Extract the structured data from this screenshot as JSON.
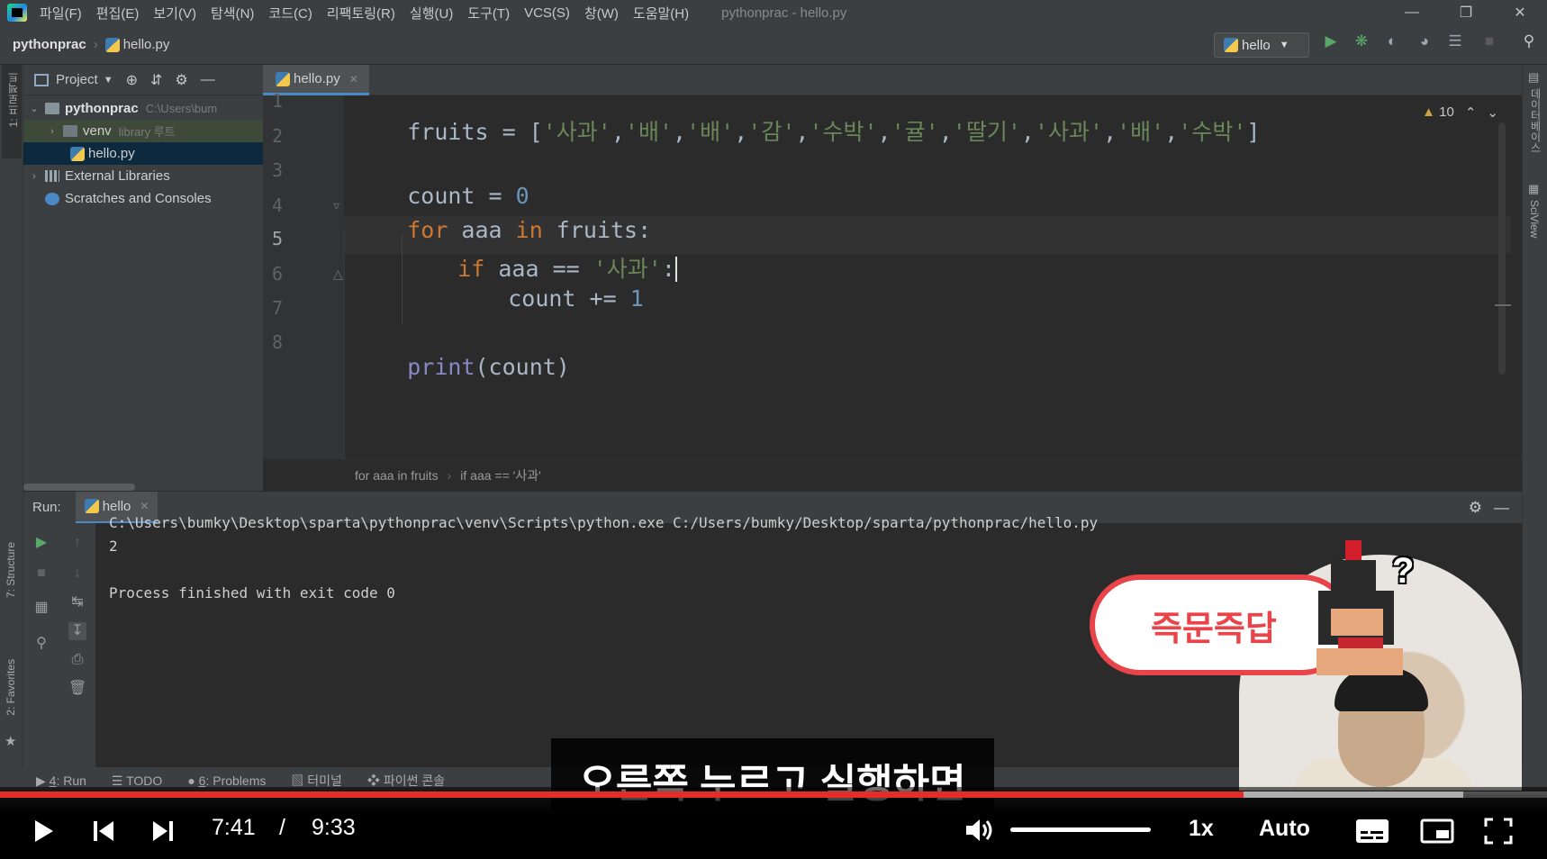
{
  "menu": {
    "items": [
      "파일(F)",
      "편집(E)",
      "보기(V)",
      "탐색(N)",
      "코드(C)",
      "리팩토링(R)",
      "실행(U)",
      "도구(T)",
      "VCS(S)",
      "창(W)",
      "도움말(H)"
    ],
    "window_title": "pythonprac - hello.py"
  },
  "navbar": {
    "project": "pythonprac",
    "file": "hello.py",
    "run_config": "hello"
  },
  "left_strip": {
    "project_label": "1: 프로젝트",
    "structure_label": "7: Structure",
    "favorites_label": "2: Favorites"
  },
  "right_strip": {
    "database_label": "데이터베이스",
    "sciview_label": "SciView"
  },
  "project_panel": {
    "title": "Project",
    "root": {
      "name": "pythonprac",
      "path": "C:\\Users\\bum"
    },
    "venv": {
      "name": "venv",
      "hint": "library 루트"
    },
    "file": "hello.py",
    "external_libraries": "External Libraries",
    "scratches": "Scratches and Consoles"
  },
  "editor": {
    "tab": "hello.py",
    "inspection_count": "10",
    "line_numbers": [
      "1",
      "2",
      "3",
      "4",
      "5",
      "6",
      "7",
      "8"
    ],
    "code": {
      "l1_var": "fruits",
      "l1_op": " = [",
      "l1_items": [
        "'사과'",
        "'배'",
        "'배'",
        "'감'",
        "'수박'",
        "'귤'",
        "'딸기'",
        "'사과'",
        "'배'",
        "'수박'"
      ],
      "l1_sep": ",",
      "l1_close": "]",
      "l3_var": "count",
      "l3_op": " = ",
      "l3_num": "0",
      "l4_for": "for",
      "l4_var": " aaa ",
      "l4_in": "in",
      "l4_rest": " fruits:",
      "l5_if": "if",
      "l5_mid": " aaa == ",
      "l5_str": "'사과'",
      "l5_colon": ":",
      "l6_left": "count += ",
      "l6_num": "1",
      "l8_print": "print",
      "l8_rest": "(count)"
    },
    "breadcrumb": [
      "for aaa in fruits",
      "if aaa == '사과'"
    ]
  },
  "run": {
    "label": "Run:",
    "tab": "hello",
    "console": [
      "C:\\Users\\bumky\\Desktop\\sparta\\pythonprac\\venv\\Scripts\\python.exe C:/Users/bumky/Desktop/sparta/pythonprac/hello.py",
      "2",
      "",
      "Process finished with exit code 0"
    ]
  },
  "bottom_tools": {
    "run": {
      "num": "4",
      "label": ": Run"
    },
    "todo": "TODO",
    "problems": {
      "num": "6",
      "label": ": Problems"
    },
    "terminal": "터미널",
    "python_console": "파이썬 콘솔"
  },
  "overlay": {
    "badge": "즉문즉답",
    "subtitle": "오른쪽 누르고 실행하면"
  },
  "player": {
    "current_time": "7:41",
    "separator": "/",
    "duration": "9:33",
    "speed": "1x",
    "quality": "Auto",
    "progress_fraction": 0.804,
    "buffered_fraction": 0.946,
    "accent_color": "#e52d27"
  }
}
